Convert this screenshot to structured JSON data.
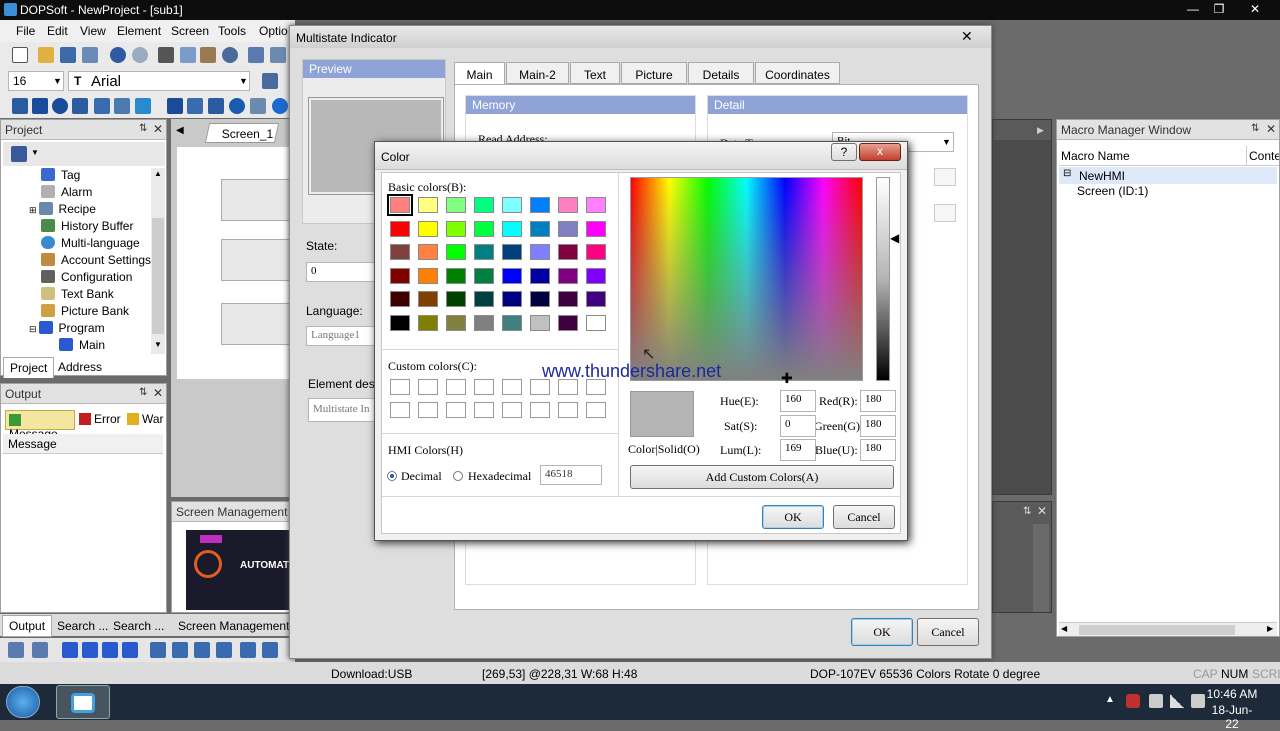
{
  "app": {
    "title": "DOPSoft - NewProject - [sub1]"
  },
  "menu": [
    "File",
    "Edit",
    "View",
    "Element",
    "Screen",
    "Tools",
    "Optio"
  ],
  "font": {
    "size": "16",
    "name": "Arial"
  },
  "project": {
    "header": "Project",
    "items": [
      "Tag",
      "Alarm",
      "Recipe",
      "History Buffer",
      "Multi-language",
      "Account Settings",
      "Configuration",
      "Text Bank",
      "Picture Bank",
      "Program",
      "Main"
    ],
    "tabs": [
      "Project",
      "Address"
    ]
  },
  "output": {
    "header": "Output",
    "tabs": [
      "Message",
      "Error",
      "War"
    ],
    "column": "Message"
  },
  "screen_tab": "Screen_1",
  "screen_mgmt": {
    "header": "Screen Management W",
    "bottom_tabs": [
      "Output",
      "Search ...",
      "Search ...",
      "Screen Management W"
    ],
    "thumb_text": "AUTOMATI"
  },
  "macro": {
    "header": "Macro Manager Window",
    "col1": "Macro Name",
    "col2": "Conte",
    "items": [
      "NewHMI",
      "Screen (ID:1)"
    ]
  },
  "multistate": {
    "title": "Multistate Indicator",
    "preview": "Preview",
    "tabs": [
      "Main",
      "Main-2",
      "Text",
      "Picture",
      "Details",
      "Coordinates"
    ],
    "memory": "Memory",
    "detail": "Detail",
    "read_address": "Read Address:",
    "data_type": "Data Type:",
    "data_type_value": "Bit",
    "state_label": "State:",
    "state_value": "0",
    "language_label": "Language:",
    "language_value": "Language1",
    "element_desc_label": "Element descri",
    "element_desc_value": "Multistate In",
    "ok": "OK",
    "cancel": "Cancel"
  },
  "color_dialog": {
    "title": "Color",
    "help": "?",
    "close": "x",
    "basic_label": "Basic colors(B):",
    "custom_label": "Custom colors(C):",
    "hmi_label": "HMI Colors(H)",
    "decimal": "Decimal",
    "hexadecimal": "Hexadecimal",
    "hmi_value": "46518",
    "color_solid": "Color|Solid(O)",
    "hue_label": "Hue(E):",
    "hue": "160",
    "sat_label": "Sat(S):",
    "sat": "0",
    "lum_label": "Lum(L):",
    "lum": "169",
    "red_label": "Red(R):",
    "red": "180",
    "green_label": "Green(G):",
    "green": "180",
    "blue_label": "Blue(U):",
    "blue": "180",
    "add_custom": "Add Custom Colors(A)",
    "ok": "OK",
    "cancel": "Cancel",
    "current_color": "#b4b4b4"
  },
  "watermark": "www.thundershare.net",
  "basic_colors": [
    "#ff8080",
    "#ffff80",
    "#80ff80",
    "#00ff80",
    "#80ffff",
    "#0080ff",
    "#ff80c0",
    "#ff80ff",
    "#ff0000",
    "#ffff00",
    "#80ff00",
    "#00ff40",
    "#00ffff",
    "#0080c0",
    "#8080c0",
    "#ff00ff",
    "#804040",
    "#ff8040",
    "#00ff00",
    "#008080",
    "#004080",
    "#8080ff",
    "#800040",
    "#ff0080",
    "#800000",
    "#ff8000",
    "#008000",
    "#008040",
    "#0000ff",
    "#0000a0",
    "#800080",
    "#8000ff",
    "#400000",
    "#804000",
    "#004000",
    "#004040",
    "#000080",
    "#000040",
    "#400040",
    "#400080",
    "#000000",
    "#808000",
    "#808040",
    "#808080",
    "#408080",
    "#c0c0c0",
    "#400040",
    "#ffffff"
  ],
  "status": {
    "download": "Download:USB",
    "coords": "[269,53] @228,31 W:68 H:48",
    "device": "DOP-107EV 65536 Colors Rotate 0 degree",
    "cap": "CAP",
    "num": "NUM",
    "scrl": "SCRL"
  },
  "clock": {
    "time": "10:46 AM",
    "date": "18-Jun-22"
  }
}
